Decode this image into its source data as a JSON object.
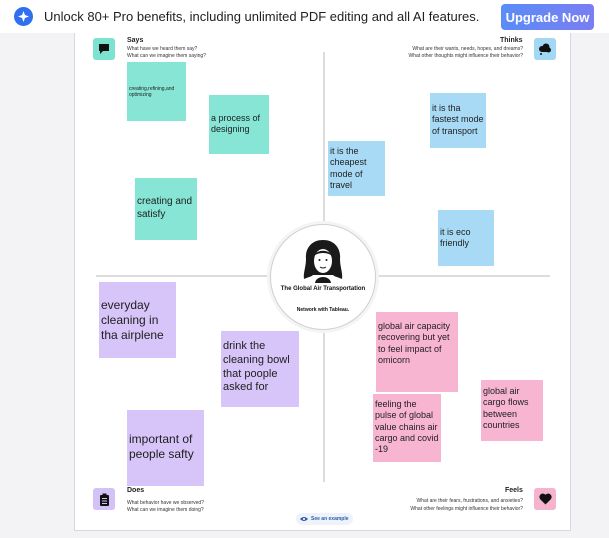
{
  "banner": {
    "icon": "ai-spark-icon",
    "text": "Unlock 80+ Pro benefits, including unlimited PDF editing and all AI features.",
    "button_label": "Upgrade Now"
  },
  "quadrants": {
    "says": {
      "title": "Says",
      "line1": "What have we heard them say?",
      "line2": "What can we imagine them saying?",
      "icon": "speech-bubble-icon",
      "color": "#7de3d1"
    },
    "thinks": {
      "title": "Thinks",
      "line1": "What are their wants, needs, hopes, and dreams?",
      "line2": "What other thoughts might influence their behavior?",
      "icon": "thought-cloud-icon",
      "color": "#a3d8f5"
    },
    "does": {
      "title": "Does",
      "line1": "What behavior have we observed?",
      "line2": "What can we imagine them doing?",
      "icon": "clipboard-icon",
      "color": "#d3c2f8"
    },
    "feels": {
      "title": "Feels",
      "line1": "What are their fears, frustrations, and anxieties?",
      "line2": "What other feelings might influence their behavior?",
      "icon": "heart-icon",
      "color": "#f6b3ce"
    }
  },
  "persona": {
    "name": "The Global Air Transportation",
    "subtitle": "Network with Tableau."
  },
  "notes": {
    "says": [
      "creating,refining,and optimizing",
      "a process of designing",
      "creating and satisfy"
    ],
    "thinks": [
      "it is tha fastest mode of transport",
      "it is the cheapest mode of travel",
      "it is eco friendly"
    ],
    "does": [
      "everyday cleaning in  tha airplene",
      "drink the cleaning bowl that poople asked for",
      "important of people safty"
    ],
    "feels": [
      "global air capacity recovering but yet to feel impact of omicorn",
      "feeling the pulse of global value chains air cargo and covid -19",
      "global air cargo flows between countries"
    ]
  },
  "footer": {
    "see_example_label": "See an example",
    "icon": "eye-icon"
  }
}
